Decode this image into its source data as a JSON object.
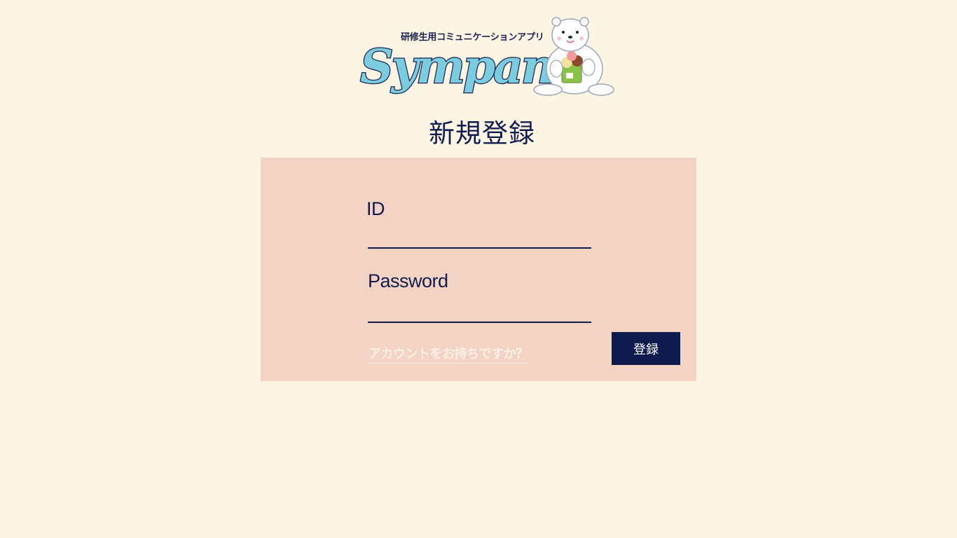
{
  "logo": {
    "tagline": "研修生用コミュニケーションアプリ",
    "wordmark": "Sympany",
    "mascot": "polar-bear-icon",
    "wordmark_color": "#7CCCE0",
    "wordmark_outline": "#1A2150"
  },
  "page": {
    "title": "新規登録",
    "background": "#FDF5E4"
  },
  "form": {
    "card_color": "#F2D3C4",
    "id_label": "ID",
    "id_value": "",
    "password_label": "Password",
    "password_value": "",
    "account_link": "アカウントをお持ちですか？",
    "submit_label": "登録",
    "submit_color": "#0F1A4E"
  }
}
